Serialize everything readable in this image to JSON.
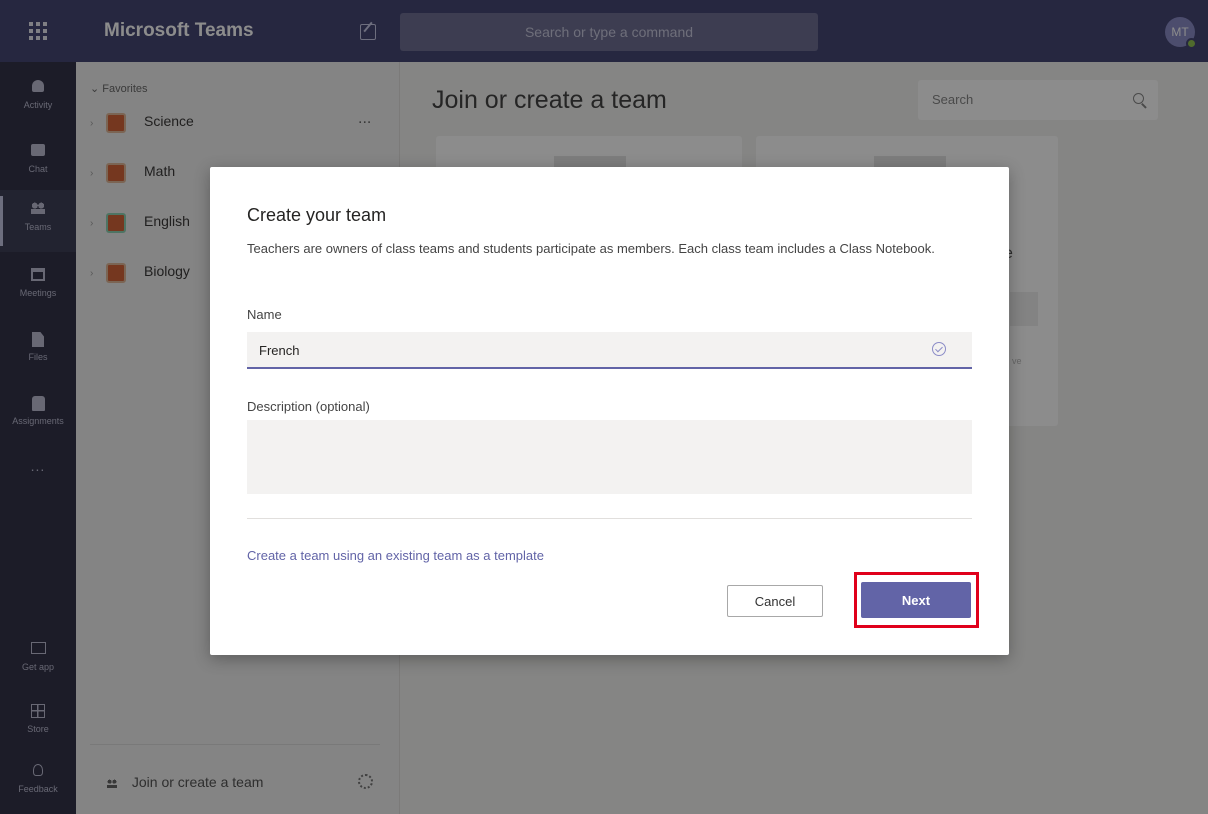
{
  "app": {
    "title": "Microsoft Teams",
    "search_placeholder": "Search or type a command",
    "avatar_initials": "MT"
  },
  "rail": {
    "items": [
      {
        "label": "Activity",
        "icon": "bell-icon"
      },
      {
        "label": "Chat",
        "icon": "chat-icon"
      },
      {
        "label": "Teams",
        "icon": "teams-icon"
      },
      {
        "label": "Meetings",
        "icon": "calendar-icon"
      },
      {
        "label": "Files",
        "icon": "file-icon"
      },
      {
        "label": "Assignments",
        "icon": "assignments-icon"
      },
      {
        "label": "...",
        "icon": "more-icon"
      }
    ],
    "bottom_items": [
      {
        "label": "Get app",
        "icon": "download-icon"
      },
      {
        "label": "Store",
        "icon": "store-icon"
      },
      {
        "label": "Feedback",
        "icon": "lightbulb-icon"
      }
    ]
  },
  "sidebar": {
    "favorites_label": "Favorites",
    "teams": [
      {
        "name": "Science",
        "more": "..."
      },
      {
        "name": "Math"
      },
      {
        "name": "English"
      },
      {
        "name": "Biology"
      }
    ],
    "join_label": "Join or create a team"
  },
  "main": {
    "title": "Join or create a team",
    "search_placeholder": "Search",
    "card_peek_text": "e",
    "card_peek_small": "ve"
  },
  "dialog": {
    "title": "Create your team",
    "description": "Teachers are owners of class teams and students participate as members. Each class team includes a Class Notebook.",
    "name_label": "Name",
    "name_value": "French",
    "description_label": "Description (optional)",
    "description_value": "",
    "template_link": "Create a team using an existing team as a template",
    "cancel_label": "Cancel",
    "next_label": "Next"
  },
  "colors": {
    "topbar": "#464775",
    "rail": "#33344a",
    "accent": "#6264a7",
    "highlight": "#e0001b"
  }
}
